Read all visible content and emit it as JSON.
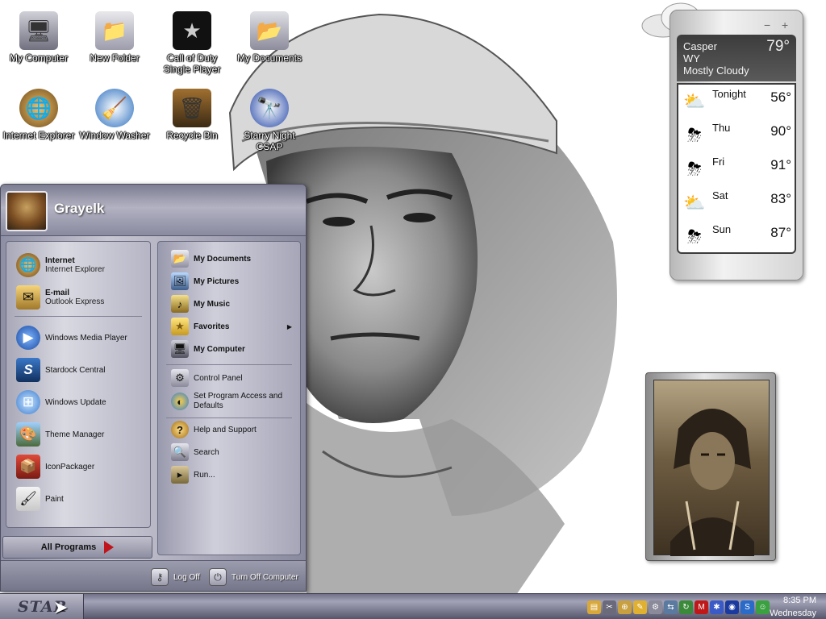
{
  "desktop_icons": [
    {
      "label": "My Computer",
      "icon": "monitor-icon",
      "glyph": "🖥"
    },
    {
      "label": "New Folder",
      "icon": "folder-icon",
      "glyph": "📁"
    },
    {
      "label": "Call of Duty Single Player",
      "icon": "star-icon",
      "glyph": "★"
    },
    {
      "label": "My Documents",
      "icon": "documents-folder-icon",
      "glyph": "📂"
    },
    {
      "label": "Internet Explorer",
      "icon": "internet-explorer-icon",
      "glyph": "🌐"
    },
    {
      "label": "Window Washer",
      "icon": "washer-icon",
      "glyph": "🧹"
    },
    {
      "label": "Recycle Bin",
      "icon": "recycle-bin-icon",
      "glyph": "🗑"
    },
    {
      "label": "Starry Night CSAP",
      "icon": "observatory-icon",
      "glyph": "🔭"
    }
  ],
  "start_menu": {
    "username": "Grayelk",
    "pinned": [
      {
        "title": "Internet",
        "subtitle": "Internet Explorer",
        "icon": "internet-explorer-icon",
        "glyph": "🌐"
      },
      {
        "title": "E-mail",
        "subtitle": "Outlook Express",
        "icon": "email-icon",
        "glyph": "✉"
      }
    ],
    "recent": [
      {
        "label": "Windows Media Player",
        "icon": "media-player-icon",
        "glyph": "▶"
      },
      {
        "label": "Stardock Central",
        "icon": "stardock-icon",
        "glyph": "S"
      },
      {
        "label": "Windows Update",
        "icon": "windows-update-icon",
        "glyph": "⊞"
      },
      {
        "label": "Theme Manager",
        "icon": "theme-manager-icon",
        "glyph": "🎨"
      },
      {
        "label": "IconPackager",
        "icon": "iconpackager-icon",
        "glyph": "📦"
      },
      {
        "label": "Paint",
        "icon": "paint-icon",
        "glyph": "🖌"
      }
    ],
    "all_programs": "All Programs",
    "places": [
      {
        "label": "My Documents",
        "icon": "documents-folder-icon",
        "glyph": "📂"
      },
      {
        "label": "My Pictures",
        "icon": "pictures-icon",
        "glyph": "🖼"
      },
      {
        "label": "My Music",
        "icon": "music-icon",
        "glyph": "♪"
      },
      {
        "label": "Favorites",
        "icon": "favorites-icon",
        "glyph": "★",
        "submenu": true
      },
      {
        "label": "My Computer",
        "icon": "monitor-icon",
        "glyph": "🖥"
      }
    ],
    "settings": [
      {
        "label": "Control Panel",
        "icon": "control-panel-icon",
        "glyph": "⚙"
      },
      {
        "label": "Set Program Access and Defaults",
        "icon": "program-access-icon",
        "glyph": "◐"
      }
    ],
    "help": [
      {
        "label": "Help and Support",
        "icon": "help-icon",
        "glyph": "?"
      },
      {
        "label": "Search",
        "icon": "search-icon",
        "glyph": "🔍"
      },
      {
        "label": "Run...",
        "icon": "run-icon",
        "glyph": "▸"
      }
    ],
    "log_off": "Log Off",
    "turn_off": "Turn Off Computer"
  },
  "weather": {
    "city": "Casper",
    "state": "WY",
    "condition": "Mostly Cloudy",
    "current_temp": "79°",
    "forecast": [
      {
        "day": "Tonight",
        "temp": "56°",
        "icon": "partly-cloudy-icon"
      },
      {
        "day": "Thu",
        "temp": "90°",
        "icon": "thunderstorm-icon"
      },
      {
        "day": "Fri",
        "temp": "91°",
        "icon": "thunderstorm-icon"
      },
      {
        "day": "Sat",
        "temp": "83°",
        "icon": "partly-cloudy-icon"
      },
      {
        "day": "Sun",
        "temp": "87°",
        "icon": "thunderstorm-icon"
      }
    ],
    "minimize_label": "−",
    "add_label": "+"
  },
  "taskbar": {
    "start_label": "STAR",
    "time": "8:35 PM",
    "day": "Wednesday",
    "tray_icons": [
      "folder-tray-icon",
      "tools-tray-icon",
      "crosshair-tray-icon",
      "pencil-tray-icon",
      "gear-tray-icon",
      "network-tray-icon",
      "update-tray-icon",
      "mcafee-tray-icon",
      "star-tray-icon",
      "volume-tray-icon",
      "sync-tray-icon",
      "messenger-tray-icon"
    ]
  },
  "colors": {
    "accent": "#8e8ea4",
    "taskbar": "#6f6f88"
  }
}
